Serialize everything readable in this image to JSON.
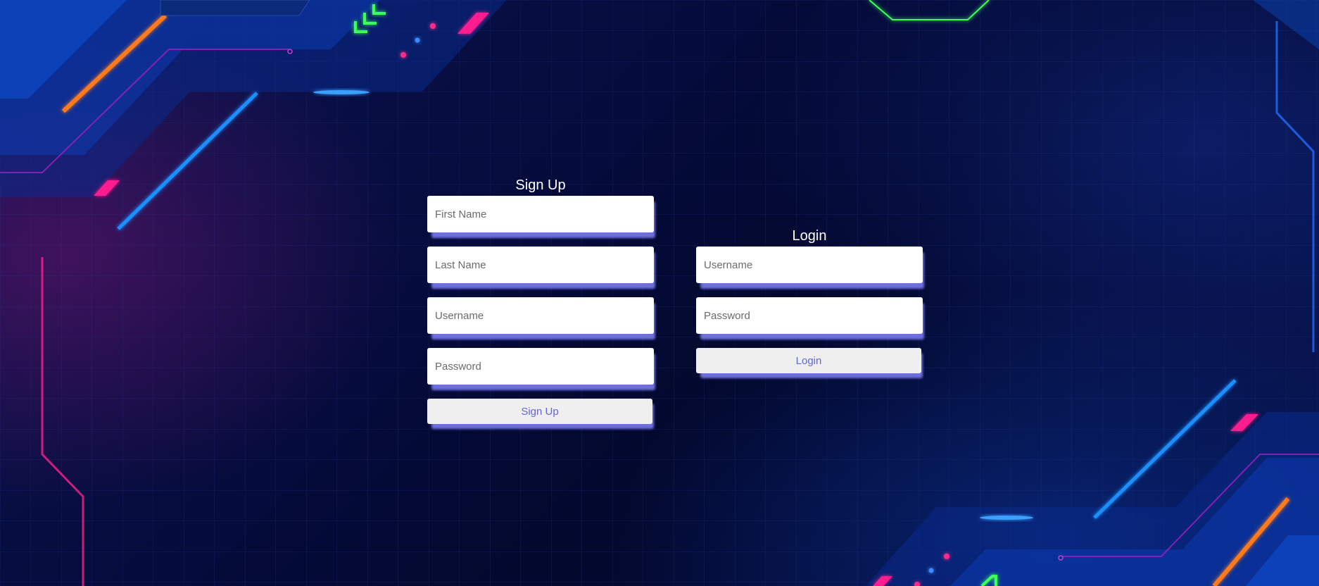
{
  "signup": {
    "title": "Sign Up",
    "first_name_placeholder": "First Name",
    "last_name_placeholder": "Last Name",
    "username_placeholder": "Username",
    "password_placeholder": "Password",
    "submit_label": "Sign Up"
  },
  "login": {
    "title": "Login",
    "username_placeholder": "Username",
    "password_placeholder": "Password",
    "submit_label": "Login"
  },
  "colors": {
    "background": "#04092f",
    "button_text": "#6366d8",
    "field_shadow": "#6d6ee0",
    "neon_blue": "#1e8fff",
    "neon_orange": "#ff7a1a",
    "neon_pink": "#ff1f8f",
    "neon_green": "#3cff5a"
  }
}
